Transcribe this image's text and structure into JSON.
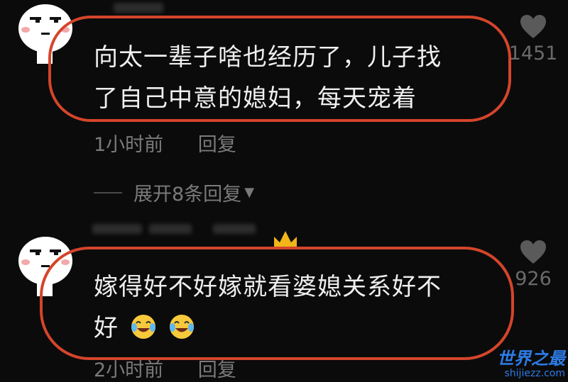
{
  "comments": [
    {
      "text_line1": "向太一辈子啥也经历了，儿子找",
      "text_line2": "了自己中意的媳妇，每天宠着",
      "likes": "1451",
      "time": "1小时前",
      "reply_label": "回复"
    },
    {
      "text_line1": "嫁得好不好嫁就看婆媳关系好不",
      "text_line2": "好",
      "likes": "926",
      "time": "2小时前",
      "reply_label": "回复"
    }
  ],
  "expand_label": "展开8条回复",
  "watermark": {
    "title": "世界之最",
    "url": "shijiezz.com"
  },
  "colors": {
    "highlight_ring": "#d4452b",
    "background": "#0b0b0b",
    "watermark": "#2d7be5"
  }
}
